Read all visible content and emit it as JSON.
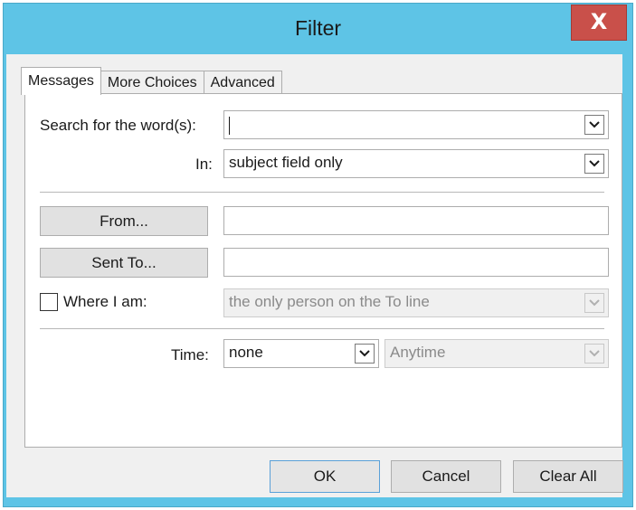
{
  "window": {
    "title": "Filter",
    "close_glyph": "X"
  },
  "tabs": [
    {
      "label": "Messages",
      "active": true
    },
    {
      "label": "More Choices",
      "active": false
    },
    {
      "label": "Advanced",
      "active": false
    }
  ],
  "messages": {
    "search_label": "Search for the word(s):",
    "search_value": "",
    "in_label": "In:",
    "in_value": "subject field only",
    "from_button": "From...",
    "from_value": "",
    "sent_to_button": "Sent To...",
    "sent_to_value": "",
    "where_i_am_label": "Where I am:",
    "where_i_am_checked": false,
    "where_i_am_value": "the only person on the To line",
    "time_label": "Time:",
    "time_value": "none",
    "time_range_value": "Anytime"
  },
  "footer": {
    "ok_label": "OK",
    "cancel_label": "Cancel",
    "clear_all_label": "Clear All"
  },
  "colors": {
    "titlebar": "#5ec4e6",
    "close_button": "#c9504a",
    "dialog_body": "#f0f0f0",
    "ok_border": "#5aa0d8"
  },
  "icons": {
    "close": "close-icon",
    "dropdown": "chevron-down-icon"
  }
}
